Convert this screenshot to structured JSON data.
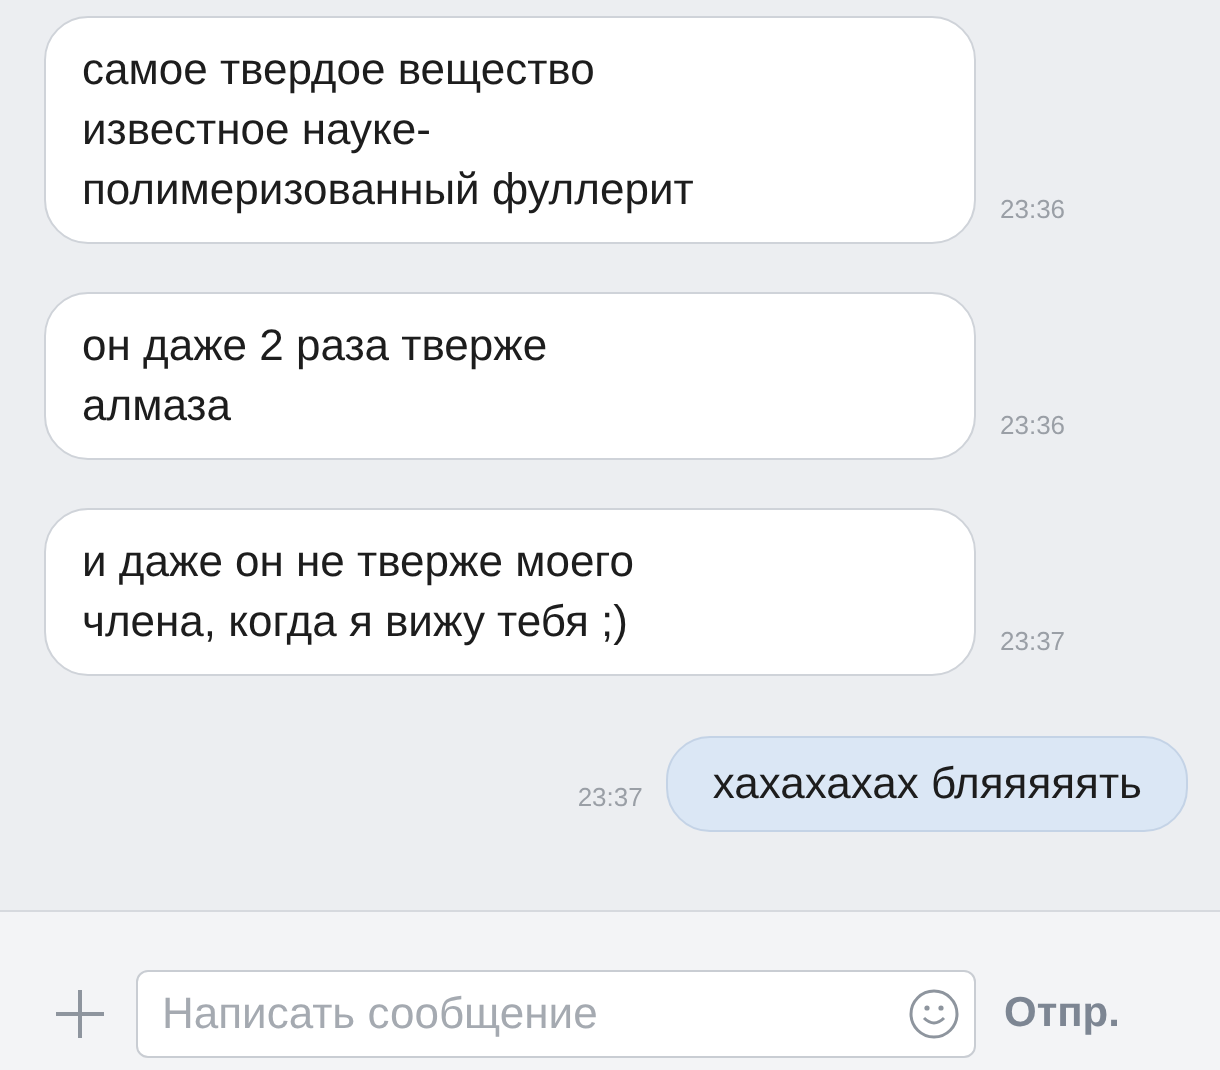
{
  "messages": [
    {
      "kind": "incoming",
      "text": "самое твердое вещество\nизвестное науке-\nполимеризованный фуллерит",
      "time": "23:36"
    },
    {
      "kind": "incoming",
      "text": "он даже 2 раза тверже\nалмаза",
      "time": "23:36"
    },
    {
      "kind": "incoming",
      "text": "и даже он не тверже моего\nчлена, когда я вижу тебя ;)",
      "time": "23:37"
    },
    {
      "kind": "outgoing",
      "text": "хахахахах бляяяяять",
      "time": "23:37"
    }
  ],
  "composer": {
    "placeholder": "Написать сообщение",
    "send_label": "Отпр."
  }
}
